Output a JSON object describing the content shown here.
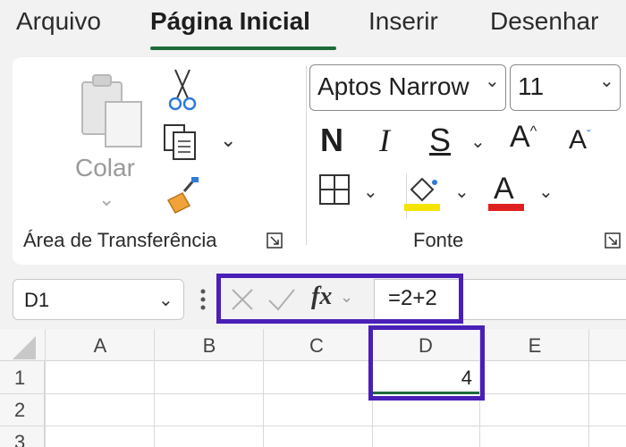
{
  "tabs": {
    "file": "Arquivo",
    "home": "Página Inicial",
    "insert": "Inserir",
    "draw": "Desenhar"
  },
  "clipboard": {
    "paste_label": "Colar",
    "group_label": "Área de Transferência"
  },
  "font": {
    "name_value": "Aptos Narrow",
    "size_value": "11",
    "bold_label": "N",
    "italic_label": "I",
    "underline_label": "S",
    "group_label": "Fonte"
  },
  "formula_bar": {
    "name_box": "D1",
    "fx_label": "fx",
    "formula": "=2+2"
  },
  "grid": {
    "columns": [
      "A",
      "B",
      "C",
      "D",
      "E"
    ],
    "rows": [
      "1",
      "2",
      "3"
    ],
    "d1_value": "4"
  },
  "colors": {
    "accent_green": "#1e6b3a",
    "highlight_purple": "#4a1fb8",
    "fill_yellow": "#f5e400",
    "font_red": "#e0201f"
  },
  "icons": [
    "paste-icon",
    "cut-icon",
    "copy-icon",
    "format-painter-icon",
    "borders-icon",
    "fill-color-icon",
    "font-color-icon",
    "cancel-icon",
    "enter-icon",
    "fx-icon"
  ]
}
